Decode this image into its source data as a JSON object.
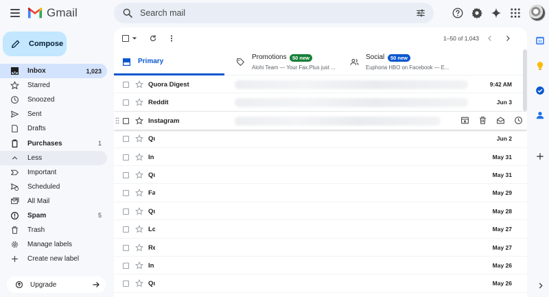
{
  "app": {
    "title": "Gmail"
  },
  "search": {
    "placeholder": "Search mail"
  },
  "compose": {
    "label": "Compose"
  },
  "nav": [
    {
      "label": "Inbox",
      "count": "1,023",
      "bold": true,
      "active": true,
      "icon": "inbox-icon"
    },
    {
      "label": "Starred",
      "count": "",
      "icon": "star-icon"
    },
    {
      "label": "Snoozed",
      "count": "",
      "icon": "clock-icon"
    },
    {
      "label": "Sent",
      "count": "",
      "icon": "send-icon"
    },
    {
      "label": "Drafts",
      "count": "",
      "icon": "draft-icon"
    },
    {
      "label": "Purchases",
      "count": "1",
      "bold": true,
      "icon": "purchase-icon"
    },
    {
      "label": "Less",
      "count": "",
      "less": true,
      "icon": "chevron-up-icon"
    },
    {
      "label": "Important",
      "count": "",
      "icon": "important-icon"
    },
    {
      "label": "Scheduled",
      "count": "",
      "icon": "scheduled-icon"
    },
    {
      "label": "All Mail",
      "count": "",
      "icon": "all-mail-icon"
    },
    {
      "label": "Spam",
      "count": "5",
      "bold": true,
      "icon": "spam-icon"
    },
    {
      "label": "Trash",
      "count": "",
      "icon": "trash-icon"
    },
    {
      "label": "Manage labels",
      "count": "",
      "icon": "gear-icon"
    },
    {
      "label": "Create new label",
      "count": "",
      "icon": "plus-icon"
    }
  ],
  "upgrade": {
    "label": "Upgrade"
  },
  "toolbar": {
    "pager": "1–50 of 1,043"
  },
  "tabs": {
    "primary": {
      "label": "Primary"
    },
    "promotions": {
      "label": "Promotions",
      "badge": "50 new",
      "sub": "Alohi Team — Your Fax.Plus just ..."
    },
    "social": {
      "label": "Social",
      "badge": "50 new",
      "sub": "Euphoria HBO on Facebook — E..."
    }
  },
  "emails": [
    {
      "sender": "Quora Digest",
      "date": "9:42 AM"
    },
    {
      "sender": "Reddit",
      "date": "Jun 3"
    },
    {
      "sender": "Instagram",
      "date": "",
      "hover": true
    },
    {
      "sender": "Qı",
      "date": "Jun 2"
    },
    {
      "sender": "In",
      "date": "May 31"
    },
    {
      "sender": "Qı",
      "date": "May 31"
    },
    {
      "sender": "Fa",
      "date": "May 29"
    },
    {
      "sender": "Qı",
      "date": "May 28"
    },
    {
      "sender": "Lo",
      "date": "May 27"
    },
    {
      "sender": "Re",
      "date": "May 27"
    },
    {
      "sender": "In",
      "date": "May 26"
    },
    {
      "sender": "Qı",
      "date": "May 26"
    }
  ],
  "colors": {
    "primary_tab": "#0b57d0",
    "promotions_badge": "#188038",
    "social_badge": "#0b57d0",
    "compose_bg": "#c2e7ff",
    "active_nav": "#d3e3fd"
  }
}
